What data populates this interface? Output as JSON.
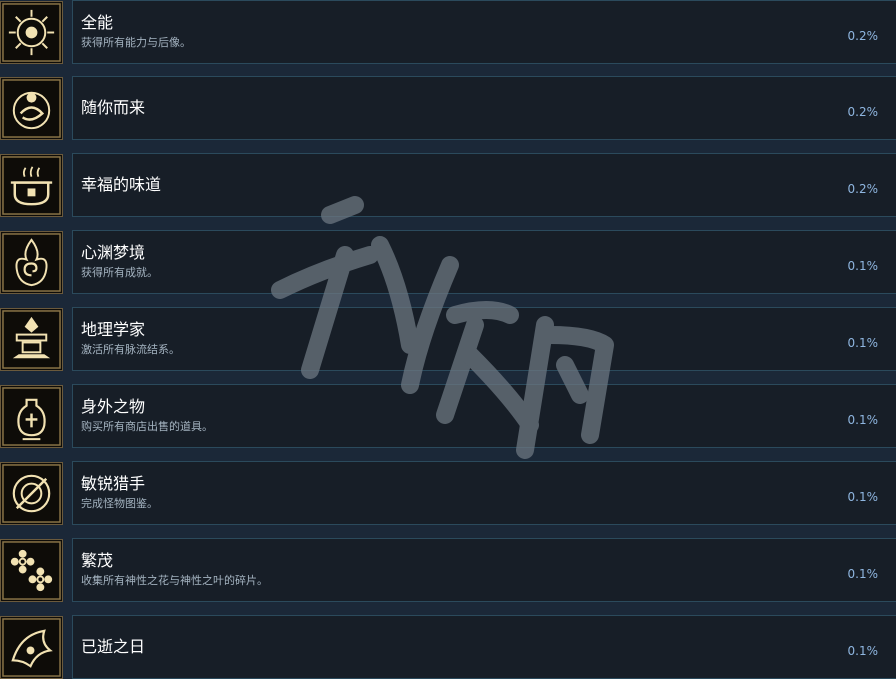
{
  "achievements": [
    {
      "title": "全能",
      "desc": "获得所有能力与后像。",
      "pct": "0.2%",
      "icon": "sun-emblem-icon"
    },
    {
      "title": "随你而来",
      "desc": "",
      "pct": "0.2%",
      "icon": "spirit-swirl-icon"
    },
    {
      "title": "幸福的味道",
      "desc": "",
      "pct": "0.2%",
      "icon": "cooking-pot-icon"
    },
    {
      "title": "心渊梦境",
      "desc": "获得所有成就。",
      "pct": "0.1%",
      "icon": "flame-spiral-icon"
    },
    {
      "title": "地理学家",
      "desc": "激活所有脉流结系。",
      "pct": "0.1%",
      "icon": "geography-altar-icon"
    },
    {
      "title": "身外之物",
      "desc": "购买所有商店出售的道具。",
      "pct": "0.1%",
      "icon": "treasure-vase-icon"
    },
    {
      "title": "敏锐猎手",
      "desc": "完成怪物图鉴。",
      "pct": "0.1%",
      "icon": "hunter-shield-icon"
    },
    {
      "title": "繁茂",
      "desc": "收集所有神性之花与神性之叶的碎片。",
      "pct": "0.1%",
      "icon": "flower-cluster-icon"
    },
    {
      "title": "已逝之日",
      "desc": "",
      "pct": "0.1%",
      "icon": "fading-day-icon"
    }
  ],
  "colors": {
    "background": "#1b2838",
    "card": "#171e27",
    "border": "#2b4a5c",
    "title": "#ffffff",
    "desc": "#a4b3c0",
    "percent": "#8fb6e0",
    "icon_gold": "#e8d6a0"
  }
}
